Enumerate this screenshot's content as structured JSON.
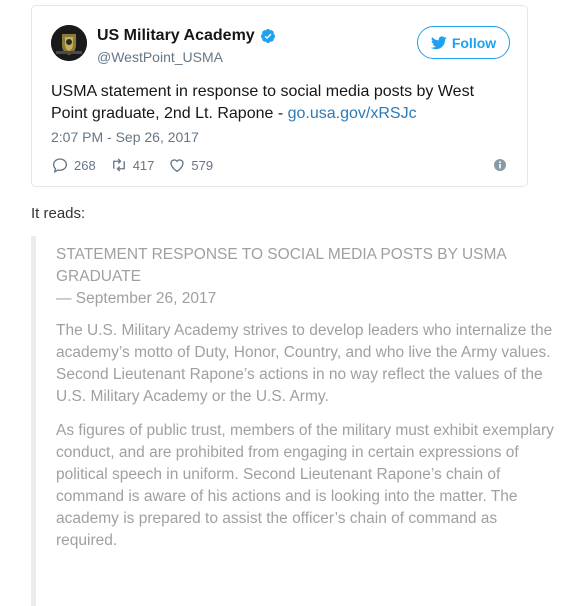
{
  "tweet": {
    "name": "US Military Academy",
    "handle": "@WestPoint_USMA",
    "follow_label": "Follow",
    "text_main": "USMA statement in response to social media posts by West Point graduate, 2nd Lt. Rapone - ",
    "link_text": "go.usa.gov/xRSJc",
    "timestamp": "2:07 PM - Sep 26, 2017",
    "reply_count": "268",
    "retweet_count": "417",
    "like_count": "579",
    "icons": [
      "verified-badge-icon",
      "twitter-bird-icon",
      "reply-icon",
      "retweet-icon",
      "heart-icon",
      "info-icon"
    ],
    "accent": "#1da1f2"
  },
  "intro": "It reads:",
  "statement": {
    "title": "STATEMENT RESPONSE TO SOCIAL MEDIA POSTS BY USMA GRADUATE",
    "date": "— September 26, 2017",
    "paragraphs": [
      "The U.S. Military Academy strives to develop leaders who internalize the academy’s motto of Duty, Honor, Country, and who live the Army values. Second Lieutenant Rapone’s actions in no way reflect the values of the U.S. Military Academy or the U.S. Army.",
      "As figures of public trust, members of the military must exhibit exemplary conduct, and are prohibited from engaging in certain expressions of political speech in uniform. Second Lieutenant Rapone’s chain of command is aware of his actions and is looking into the matter. The academy is prepared to assist the officer’s chain of command as required."
    ]
  }
}
